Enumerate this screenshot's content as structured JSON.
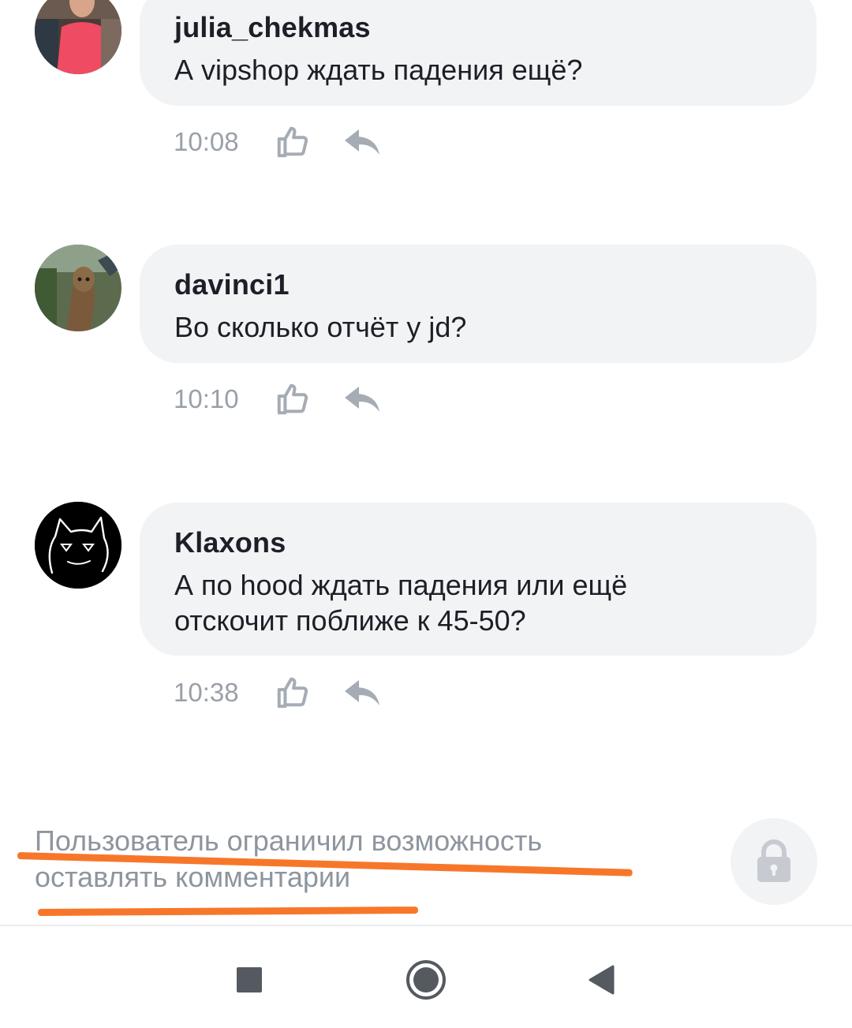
{
  "comments": [
    {
      "author": "julia_chekmas",
      "text": "А vipshop ждать падения ещё?",
      "time": "10:08",
      "avatar_icon": "user-photo-avatar"
    },
    {
      "author": "davinci1",
      "text": "Во сколько отчёт у jd?",
      "time": "10:10",
      "avatar_icon": "groot-photo-avatar"
    },
    {
      "author": "Klaxons",
      "text_line1": "А по hood ждать падения или ещё",
      "text_line2": "отскочит поближе к 45-50?",
      "time": "10:38",
      "avatar_icon": "black-cat-avatar"
    }
  ],
  "footer": {
    "restricted_line1": "Пользователь ограничил возможность",
    "restricted_line2": "оставлять комментарии",
    "lock_icon": "lock-icon",
    "highlight_color": "#f7772a"
  },
  "navbar": {
    "recents_icon": "square-icon",
    "home_icon": "circle-icon",
    "back_icon": "triangle-back-icon"
  },
  "colors": {
    "bubble": "#f2f3f5",
    "text": "#1c1f26",
    "muted": "#9aa0a8"
  }
}
